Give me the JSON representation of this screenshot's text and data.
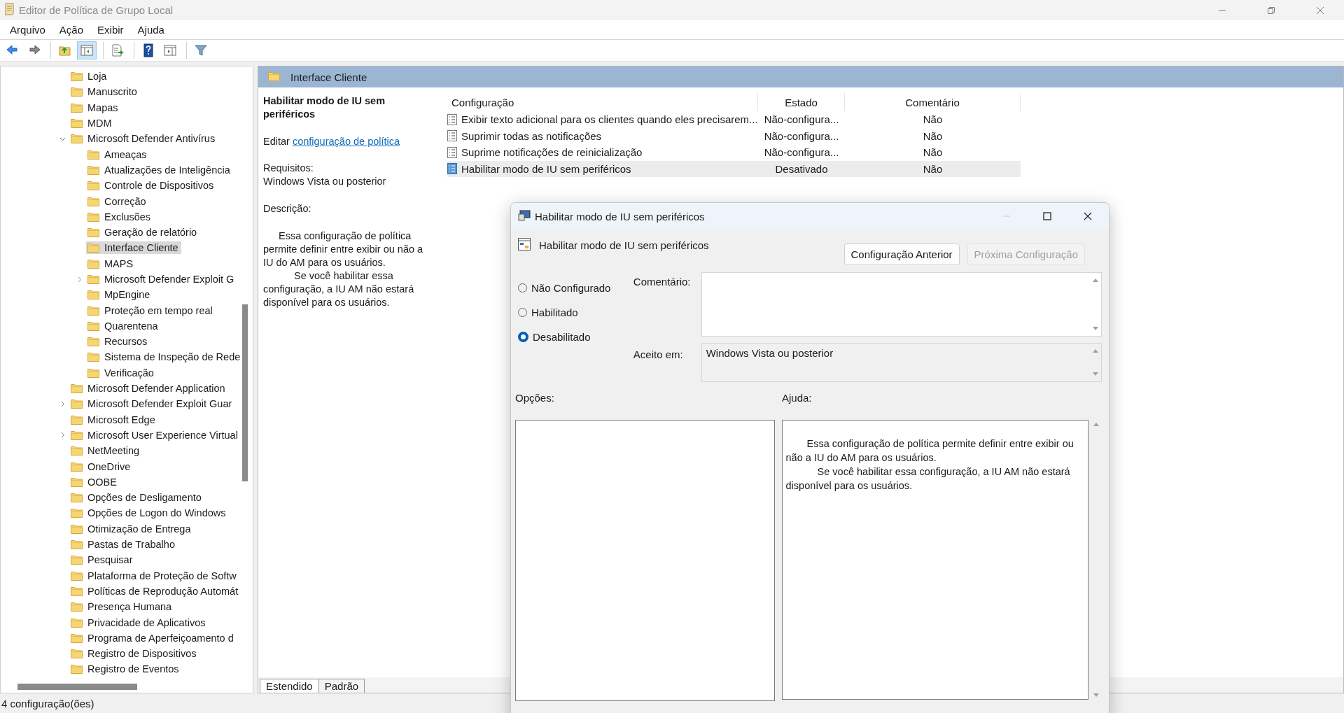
{
  "window": {
    "title": "Editor de Política de Grupo Local"
  },
  "menu": [
    "Arquivo",
    "Ação",
    "Exibir",
    "Ajuda"
  ],
  "toolbar": [
    {
      "kind": "back",
      "active": false
    },
    {
      "kind": "forward",
      "active": false
    },
    {
      "kind": "separator"
    },
    {
      "kind": "up",
      "active": false
    },
    {
      "kind": "tree",
      "active": true
    },
    {
      "kind": "separator"
    },
    {
      "kind": "export",
      "active": false
    },
    {
      "kind": "separator"
    },
    {
      "kind": "help",
      "active": false
    },
    {
      "kind": "pane",
      "active": false
    },
    {
      "kind": "separator"
    },
    {
      "kind": "filter",
      "active": false
    }
  ],
  "tree": {
    "items": [
      {
        "label": "Loja",
        "selected": false
      },
      {
        "label": "Manuscrito",
        "selected": false
      },
      {
        "label": "Mapas",
        "selected": false
      },
      {
        "label": "MDM",
        "selected": false
      },
      {
        "label": "Microsoft Defender Antivírus",
        "expanded": true,
        "selected": false,
        "children": [
          {
            "label": "Ameaças",
            "selected": false
          },
          {
            "label": "Atualizações de Inteligência",
            "selected": false
          },
          {
            "label": "Controle de Dispositivos",
            "selected": false
          },
          {
            "label": "Correção",
            "selected": false
          },
          {
            "label": "Exclusões",
            "selected": false
          },
          {
            "label": "Geração de relatório",
            "selected": false
          },
          {
            "label": "Interface Cliente",
            "selected": true
          },
          {
            "label": "MAPS",
            "selected": false
          },
          {
            "label": "Microsoft Defender Exploit G",
            "expanded": false,
            "selected": false
          },
          {
            "label": "MpEngine",
            "selected": false
          },
          {
            "label": "Proteção em tempo real",
            "selected": false
          },
          {
            "label": "Quarentena",
            "selected": false
          },
          {
            "label": "Recursos",
            "selected": false
          },
          {
            "label": "Sistema de Inspeção de Rede",
            "selected": false
          },
          {
            "label": "Verificação",
            "selected": false
          }
        ]
      },
      {
        "label": "Microsoft Defender Application",
        "selected": false
      },
      {
        "label": "Microsoft Defender Exploit Guar",
        "expanded": false,
        "selected": false
      },
      {
        "label": "Microsoft Edge",
        "selected": false
      },
      {
        "label": "Microsoft User Experience Virtual",
        "expanded": false,
        "selected": false
      },
      {
        "label": "NetMeeting",
        "selected": false
      },
      {
        "label": "OneDrive",
        "selected": false
      },
      {
        "label": "OOBE",
        "selected": false
      },
      {
        "label": "Opções de Desligamento",
        "selected": false
      },
      {
        "label": "Opções de Logon do Windows",
        "selected": false
      },
      {
        "label": "Otimização de Entrega",
        "selected": false
      },
      {
        "label": "Pastas de Trabalho",
        "selected": false
      },
      {
        "label": "Pesquisar",
        "selected": false
      },
      {
        "label": "Plataforma de Proteção de Softw",
        "selected": false
      },
      {
        "label": "Políticas de Reprodução Automát",
        "selected": false
      },
      {
        "label": "Presença Humana",
        "selected": false
      },
      {
        "label": "Privacidade de Aplicativos",
        "selected": false
      },
      {
        "label": "Programa de Aperfeiçoamento d",
        "selected": false
      },
      {
        "label": "Registro de Dispositivos",
        "selected": false
      },
      {
        "label": "Registro de Eventos",
        "selected": false
      }
    ]
  },
  "details": {
    "header": "Interface Cliente",
    "title": "Habilitar modo de IU sem periféricos",
    "edit_prefix": "Editar",
    "edit_link": "configuração de política",
    "requirements_label": "Requisitos:",
    "requirements": "Windows Vista ou posterior",
    "description_label": "Descrição:",
    "description": [
      "Essa configuração de política permite definir entre exibir ou não a IU do AM para os usuários.",
      "Se você habilitar essa configuração, a IU AM não estará disponível para os usuários."
    ]
  },
  "table": {
    "columns": [
      "Configuração",
      "Estado",
      "Comentário"
    ],
    "rows": [
      {
        "name": "Exibir texto adicional para os clientes quando eles precisarem...",
        "state": "Não-configura...",
        "comment": "Não",
        "selected": false
      },
      {
        "name": "Suprimir todas as notificações",
        "state": "Não-configura...",
        "comment": "Não",
        "selected": false
      },
      {
        "name": "Suprime notificações de reinicialização",
        "state": "Não-configura...",
        "comment": "Não",
        "selected": false
      },
      {
        "name": "Habilitar modo de IU sem periféricos",
        "state": "Desativado",
        "comment": "Não",
        "selected": true
      }
    ]
  },
  "tabs": [
    {
      "label": "Estendido",
      "selected": true
    },
    {
      "label": "Padrão",
      "selected": false
    }
  ],
  "status_bar": "4 configuração(ões)",
  "dialog": {
    "title": "Habilitar modo de IU sem periféricos",
    "heading": "Habilitar modo de IU sem periféricos",
    "buttons": [
      {
        "label": "Configuração Anterior",
        "disabled": false
      },
      {
        "label": "Próxima Configuração",
        "disabled": true
      }
    ],
    "options": [
      {
        "label": "Não Configurado",
        "selected": false
      },
      {
        "label": "Habilitado",
        "selected": false
      },
      {
        "label": "Desabilitado",
        "selected": true
      }
    ],
    "comment_label": "Comentário:",
    "accepted_label": "Aceito em:",
    "accepted_value": "Windows Vista ou posterior",
    "options_label": "Opções:",
    "help_label": "Ajuda:",
    "help": [
      "Essa configuração de política permite definir entre exibir ou não a IU do AM para os usuários.",
      "Se você habilitar essa configuração, a IU AM não estará disponível para os usuários."
    ]
  }
}
